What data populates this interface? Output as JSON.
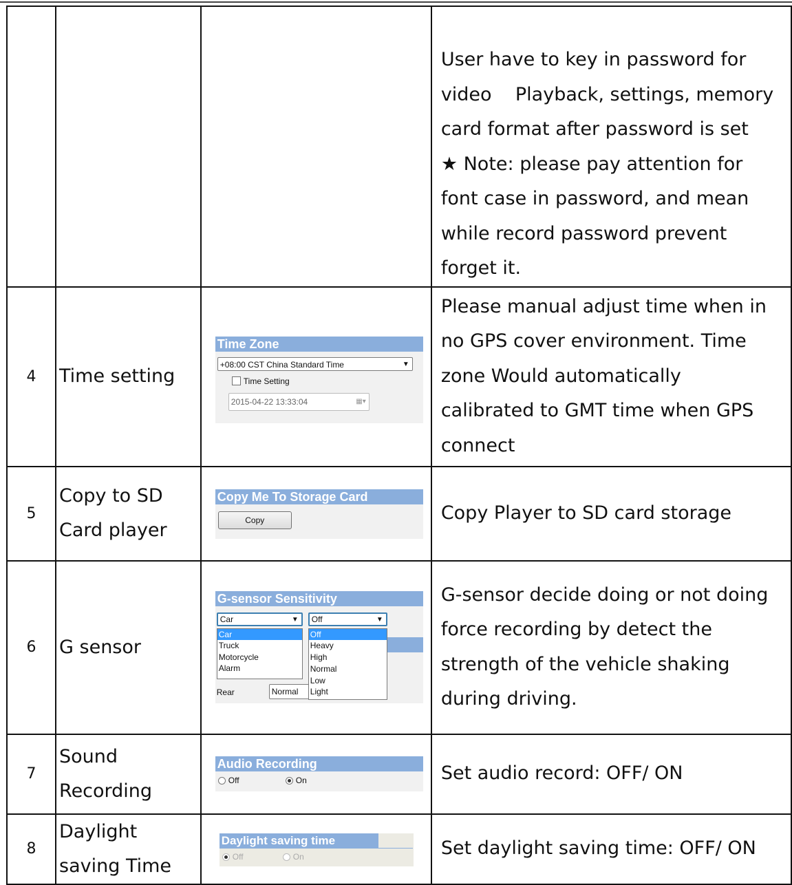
{
  "rows": [
    {
      "num": "",
      "function": "",
      "description_lines": [
        "User have to key in password for",
        "video    Playback, settings, memory",
        "card format after password is set",
        "★ Note: please pay attention for",
        "font case in password, and mean",
        "while record password prevent",
        "forget it."
      ]
    },
    {
      "num": "4",
      "function": "Time setting",
      "description_lines": [
        "Please manual adjust time when in",
        "no GPS cover environment. Time",
        "zone Would automatically",
        "calibrated to GMT time when GPS",
        "connect"
      ],
      "widget": {
        "header": "Time Zone",
        "timezone_value": "+08:00 CST China Standard Time",
        "checkbox_label": "Time Setting",
        "datetime_value": "2015-04-22 13:33:04"
      }
    },
    {
      "num": "5",
      "function": "Copy to SD Card player",
      "description_lines": [
        "Copy Player to SD card storage"
      ],
      "widget": {
        "header": "Copy Me To Storage Card",
        "button_label": "Copy"
      }
    },
    {
      "num": "6",
      "function": "G sensor",
      "description_lines": [
        "G-sensor decide doing or not doing",
        "force recording by detect the",
        "strength of the vehicle shaking",
        "during driving."
      ],
      "widget": {
        "header": "G-sensor Sensitivity",
        "mode_value": "Car",
        "mode_options": [
          "Car",
          "Truck",
          "Motorcycle",
          "Alarm"
        ],
        "level_value": "Off",
        "level_options": [
          "Off",
          "Heavy",
          "High",
          "Normal",
          "Low",
          "Light"
        ],
        "rear_label": "Rear",
        "rear_value": "Normal"
      }
    },
    {
      "num": "7",
      "function": "Sound Recording",
      "description_lines": [
        "Set audio record: OFF/ ON"
      ],
      "widget": {
        "header": "Audio Recording",
        "off_label": "Off",
        "on_label": "On",
        "selected": "On"
      }
    },
    {
      "num": "8",
      "function": "Daylight saving Time",
      "description_lines": [
        "Set daylight saving time: OFF/ ON"
      ],
      "widget": {
        "header": "Daylight saving time",
        "off_label": "Off",
        "on_label": "On",
        "selected": "Off"
      }
    }
  ]
}
